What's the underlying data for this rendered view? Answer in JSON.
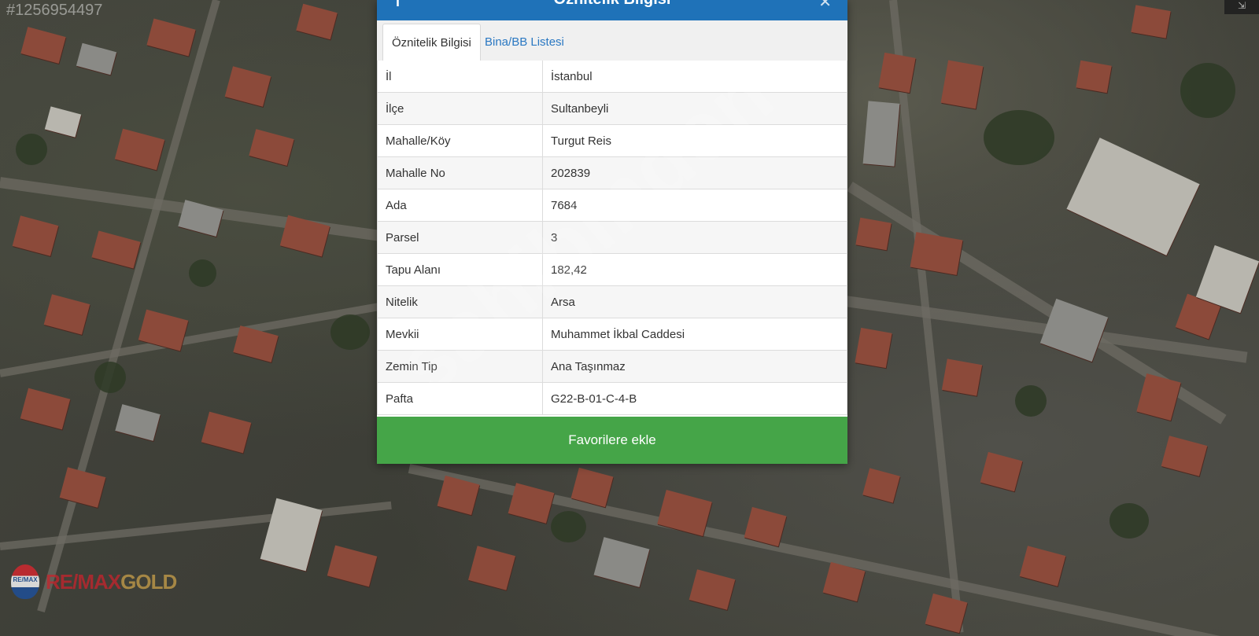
{
  "overlay": {
    "listing_id": "#1256954497",
    "watermark": "sahibinden",
    "logo": {
      "re": "RE/MAX",
      "gold": "GOLD",
      "badge": "RE/MAX"
    }
  },
  "dialog": {
    "title": "Öznitelik Bilgisi",
    "header_icons": [
      "info-icon",
      "close-icon"
    ],
    "tabs": [
      {
        "label": "Öznitelik Bilgisi",
        "active": true
      },
      {
        "label": "Bina/BB Listesi",
        "active": false
      }
    ],
    "rows": [
      {
        "key": "İl",
        "value": "İstanbul"
      },
      {
        "key": "İlçe",
        "value": "Sultanbeyli"
      },
      {
        "key": "Mahalle/Köy",
        "value": "Turgut Reis"
      },
      {
        "key": "Mahalle No",
        "value": "202839"
      },
      {
        "key": "Ada",
        "value": "7684"
      },
      {
        "key": "Parsel",
        "value": "3"
      },
      {
        "key": "Tapu Alanı",
        "value": "182,42"
      },
      {
        "key": "Nitelik",
        "value": "Arsa"
      },
      {
        "key": "Mevkii",
        "value": "Muhammet İkbal Caddesi"
      },
      {
        "key": "Zemin Tip",
        "value": "Ana Taşınmaz"
      },
      {
        "key": "Pafta",
        "value": "G22-B-01-C-4-B"
      }
    ],
    "favorite_button": "Favorilere ekle"
  },
  "colors": {
    "header": "#1f72b8",
    "button": "#45a548",
    "tab_link": "#2a78c2"
  }
}
